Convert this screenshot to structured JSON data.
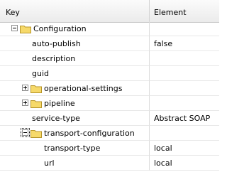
{
  "header": {
    "key_label": "Key",
    "element_label": "Element"
  },
  "rows": [
    {
      "key": "Configuration",
      "value": "",
      "kind": "folder",
      "expanded": true
    },
    {
      "key": "auto-publish",
      "value": "false",
      "kind": "leaf"
    },
    {
      "key": "description",
      "value": "",
      "kind": "leaf"
    },
    {
      "key": "guid",
      "value": "",
      "kind": "leaf"
    },
    {
      "key": "operational-settings",
      "value": "",
      "kind": "folder",
      "expanded": false
    },
    {
      "key": "pipeline",
      "value": "",
      "kind": "folder",
      "expanded": false
    },
    {
      "key": "service-type",
      "value": "Abstract SOAP",
      "kind": "leaf"
    },
    {
      "key": "transport-configuration",
      "value": "",
      "kind": "folder",
      "expanded": true
    },
    {
      "key": "transport-type",
      "value": "local",
      "kind": "leaf"
    },
    {
      "key": "url",
      "value": "local",
      "kind": "leaf"
    }
  ],
  "colors": {
    "folder_fill": "#f6d96a",
    "folder_stroke": "#b8962a"
  },
  "icons": {
    "folder": "folder-icon",
    "expand": "plus-box-icon",
    "collapse": "minus-box-icon"
  }
}
